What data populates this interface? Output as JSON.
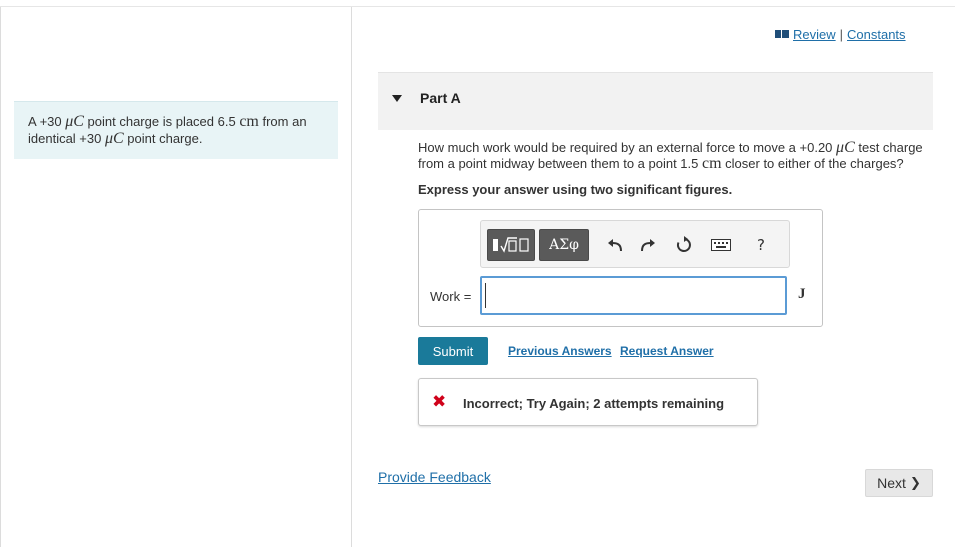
{
  "problem": {
    "segments": [
      {
        "t": "A +30 "
      },
      {
        "t": "μC",
        "math": true
      },
      {
        "t": " point charge is placed 6.5 "
      },
      {
        "t": "cm",
        "mathr": true
      },
      {
        "t": " from an identical +30 "
      },
      {
        "t": "μC",
        "math": true
      },
      {
        "t": " point charge."
      }
    ]
  },
  "links": {
    "review": "Review",
    "separator": "|",
    "constants": "Constants"
  },
  "part": {
    "title": "Part A"
  },
  "question": {
    "segments": [
      {
        "t": "How much work would be required by an external force to move a +0.20 "
      },
      {
        "t": "μC",
        "math": true
      },
      {
        "t": " test charge from a point midway between them to a point 1.5 "
      },
      {
        "t": "cm",
        "mathr": true
      },
      {
        "t": " closer to either of the charges?"
      }
    ],
    "instruction": "Express your answer using two significant figures."
  },
  "toolbar": {
    "templates_icon": "templates-icon",
    "greek_label": "ΑΣφ",
    "help_label": "?"
  },
  "answer": {
    "label": "Work =",
    "value": "",
    "unit": "J"
  },
  "actions": {
    "submit": "Submit",
    "previous_answers": "Previous Answers",
    "request_answer": "Request Answer"
  },
  "feedback": {
    "text": "Incorrect; Try Again; 2 attempts remaining"
  },
  "footer": {
    "provide_feedback": "Provide Feedback",
    "next": "Next"
  },
  "colors": {
    "link": "#1f6fa8",
    "submit_bg": "#1a7a9a",
    "problem_bg": "#e8f4f6",
    "error": "#d0021b",
    "input_border": "#5b9bd5"
  }
}
